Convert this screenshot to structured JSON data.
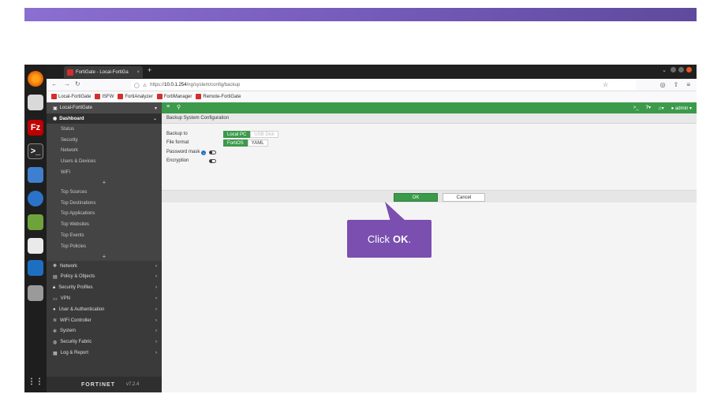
{
  "browser": {
    "tab_title": "FortiGate - Local-FortiGa",
    "tab_close": "×",
    "new_tab": "+",
    "url_prefix": "https://",
    "url_host": "10.0.1.254",
    "url_path": "/ng/system/config/backup",
    "bookmarks": [
      "Local-FortiGate",
      "ISFW",
      "FortiAnalyzer",
      "FortiManager",
      "Remote-FortiGate"
    ]
  },
  "fortigate": {
    "device_name": "Local-FortiGate",
    "dashboard_label": "Dashboard",
    "dashboard_items": [
      "Status",
      "Security",
      "Network",
      "Users & Devices",
      "WiFi"
    ],
    "fortiview_items": [
      "Top Sources",
      "Top Destinations",
      "Top Applications",
      "Top Websites",
      "Top Events",
      "Top Policies"
    ],
    "main_menu": [
      {
        "label": "Network",
        "icon": "network-icon"
      },
      {
        "label": "Policy & Objects",
        "icon": "policy-icon"
      },
      {
        "label": "Security Profiles",
        "icon": "lock-icon"
      },
      {
        "label": "VPN",
        "icon": "monitor-icon"
      },
      {
        "label": "User & Authentication",
        "icon": "user-icon"
      },
      {
        "label": "WiFi Controller",
        "icon": "wifi-icon"
      },
      {
        "label": "System",
        "icon": "gear-icon"
      },
      {
        "label": "Security Fabric",
        "icon": "fabric-icon"
      },
      {
        "label": "Log & Report",
        "icon": "chart-icon"
      }
    ],
    "logo_text": "FORTINET",
    "version": "v7.2.4",
    "admin_label": "admin",
    "breadcrumb": "Backup System Configuration",
    "form": {
      "backup_to_label": "Backup to",
      "backup_to_options": [
        "Local PC",
        "USB Disk"
      ],
      "file_format_label": "File format",
      "file_format_options": [
        "FortiOS",
        "YAML"
      ],
      "password_mask_label": "Password mask",
      "encryption_label": "Encryption"
    },
    "ok_label": "OK",
    "cancel_label": "Cancel"
  },
  "callout": {
    "prefix": "Click",
    "bold": "OK",
    "suffix": "."
  },
  "colors": {
    "fortigate_green": "#3c9a4b",
    "callout_purple": "#7a4fb0",
    "banner_purple": "#7a5fc0"
  }
}
